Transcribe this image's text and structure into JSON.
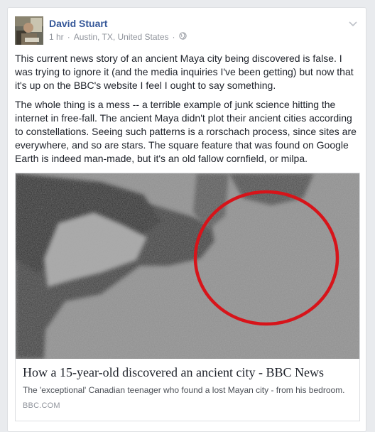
{
  "post": {
    "author": "David Stuart",
    "time": "1 hr",
    "separator": "·",
    "location": "Austin, TX, United States",
    "separator2": "·",
    "privacy_icon": "globe-icon",
    "menu_icon": "chevron-down-icon",
    "paragraphs": [
      "This current news story of an ancient Maya city being discovered is false. I was trying to ignore it (and the media inquiries I've been getting) but now that it's up on the BBC's website I feel I ought to say something.",
      "The whole thing is a mess -- a terrible example of junk science hitting the internet in free-fall. The ancient Maya didn't plot their ancient cities according to constellations. Seeing such patterns is a rorschach process, since sites are everywhere, and so are stars. The square feature that was found on Google Earth is indeed man-made, but it's an old fallow cornfield, or milpa."
    ]
  },
  "link": {
    "title": "How a 15-year-old discovered an ancient city - BBC News",
    "description": "The 'exceptional' Canadian teenager who found a lost Mayan city - from his bedroom.",
    "domain": "BBC.COM"
  },
  "colors": {
    "author_link": "#365899",
    "text": "#1d2129",
    "meta": "#90949c",
    "circle": "#d7141a",
    "page_bg": "#e9ebee"
  }
}
